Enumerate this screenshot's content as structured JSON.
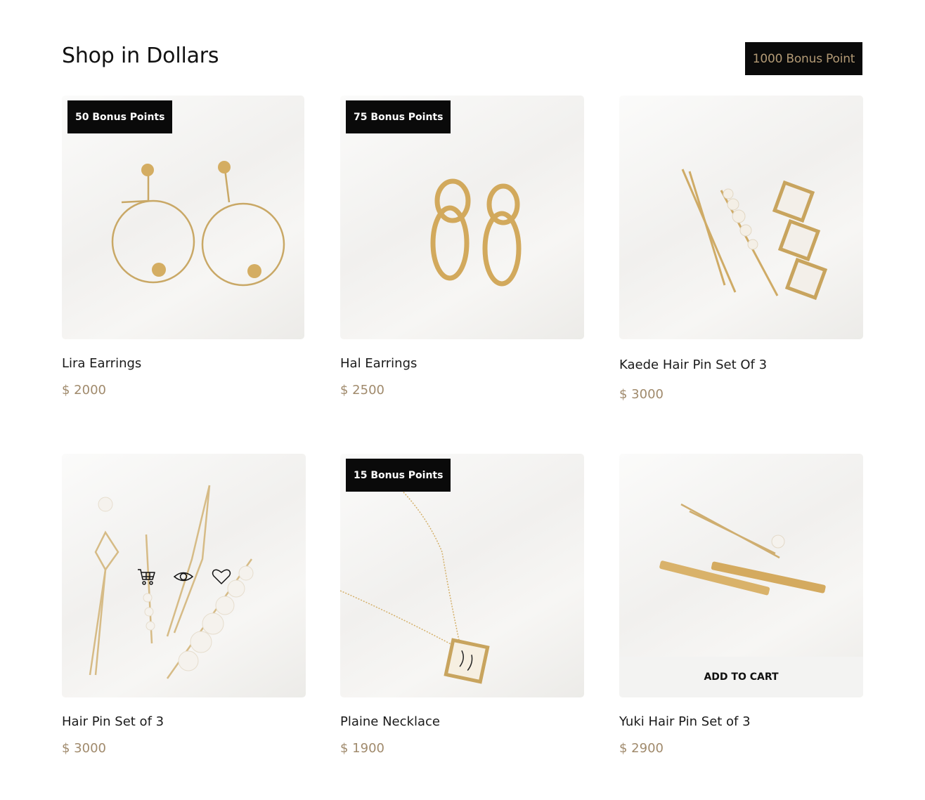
{
  "header": {
    "title": "Shop in Dollars",
    "bonus_button": "1000 Bonus Point"
  },
  "products": [
    {
      "name": "Lira Earrings",
      "price": "$ 2000",
      "badge": "50 Bonus Points"
    },
    {
      "name": "Hal Earrings",
      "price": "$ 2500",
      "badge": "75 Bonus Points"
    },
    {
      "name": "Kaede Hair Pin Set Of 3",
      "price": "$ 3000"
    },
    {
      "name": "Hair Pin Set of 3",
      "price": "$ 3000"
    },
    {
      "name": "Plaine Necklace",
      "price": "$ 1900",
      "badge": "15 Bonus Points"
    },
    {
      "name": "Yuki Hair Pin Set of 3",
      "price": "$ 2900",
      "add_to_cart": "ADD TO CART"
    }
  ],
  "icons": [
    "cart-icon",
    "eye-icon",
    "heart-icon"
  ],
  "colors": {
    "accent_gold": "#b39a75",
    "price": "#a08a6c",
    "badge_bg": "#0a0a0a"
  }
}
